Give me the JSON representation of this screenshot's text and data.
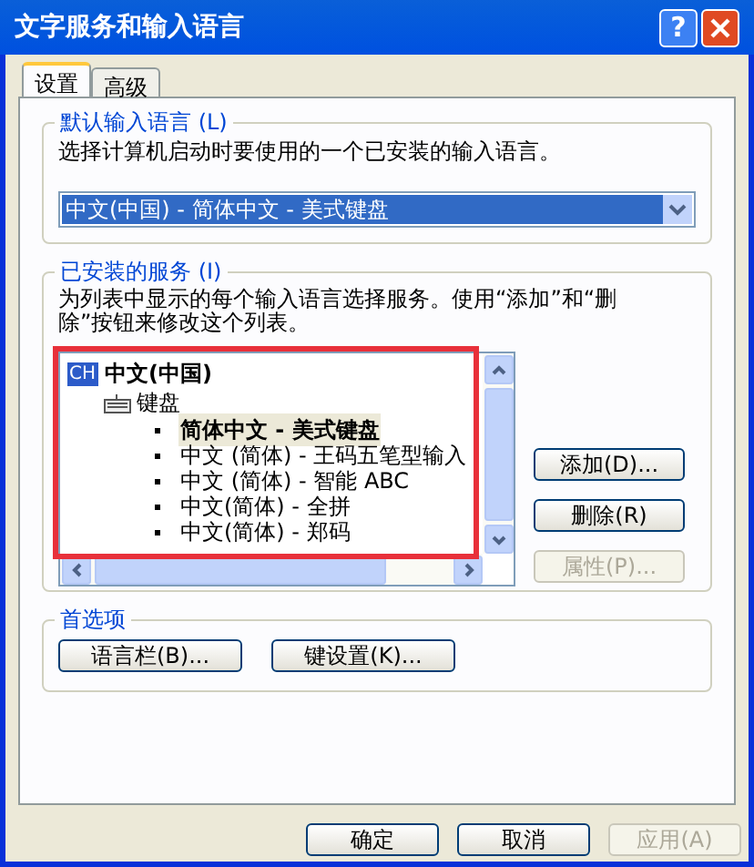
{
  "window": {
    "title": "文字服务和输入语言",
    "help": "?"
  },
  "tabs": [
    {
      "label": "设置",
      "selected": true
    },
    {
      "label": "高级",
      "selected": false
    }
  ],
  "default_language": {
    "title": "默认输入语言 (L)",
    "description": "选择计算机启动时要使用的一个已安装的输入语言。",
    "dropdown": {
      "value": "中文(中国) - 简体中文 - 美式键盘"
    }
  },
  "installed_services": {
    "title": "已安装的服务 (I)",
    "description": "为列表中显示的每个输入语言选择服务。使用“添加”和“删除”按钮来修改这个列表。",
    "tree": [
      {
        "badge": "CH",
        "label": "中文(中国)",
        "children": [
          {
            "label": "键盘",
            "children": [
              {
                "label": "简体中文 - 美式键盘",
                "selected": true
              },
              {
                "label": "中文 (简体) - 王码五笔型输入",
                "selected": false
              },
              {
                "label": "中文 (简体) - 智能 ABC",
                "selected": false
              },
              {
                "label": "中文(简体) - 全拼",
                "selected": false
              },
              {
                "label": "中文(简体) - 郑码",
                "selected": false
              }
            ]
          }
        ]
      }
    ],
    "buttons": [
      {
        "label": "添加(D)...",
        "disabled": false
      },
      {
        "label": "删除(R)",
        "disabled": false
      },
      {
        "label": "属性(P)...",
        "disabled": true
      }
    ]
  },
  "preferences": {
    "title": "首选项",
    "buttons": [
      "语言栏(B)...",
      "键设置(K)..."
    ]
  },
  "footer_buttons": [
    {
      "label": "确定",
      "disabled": false
    },
    {
      "label": "取消",
      "disabled": false
    },
    {
      "label": "应用(A)",
      "disabled": true
    }
  ]
}
